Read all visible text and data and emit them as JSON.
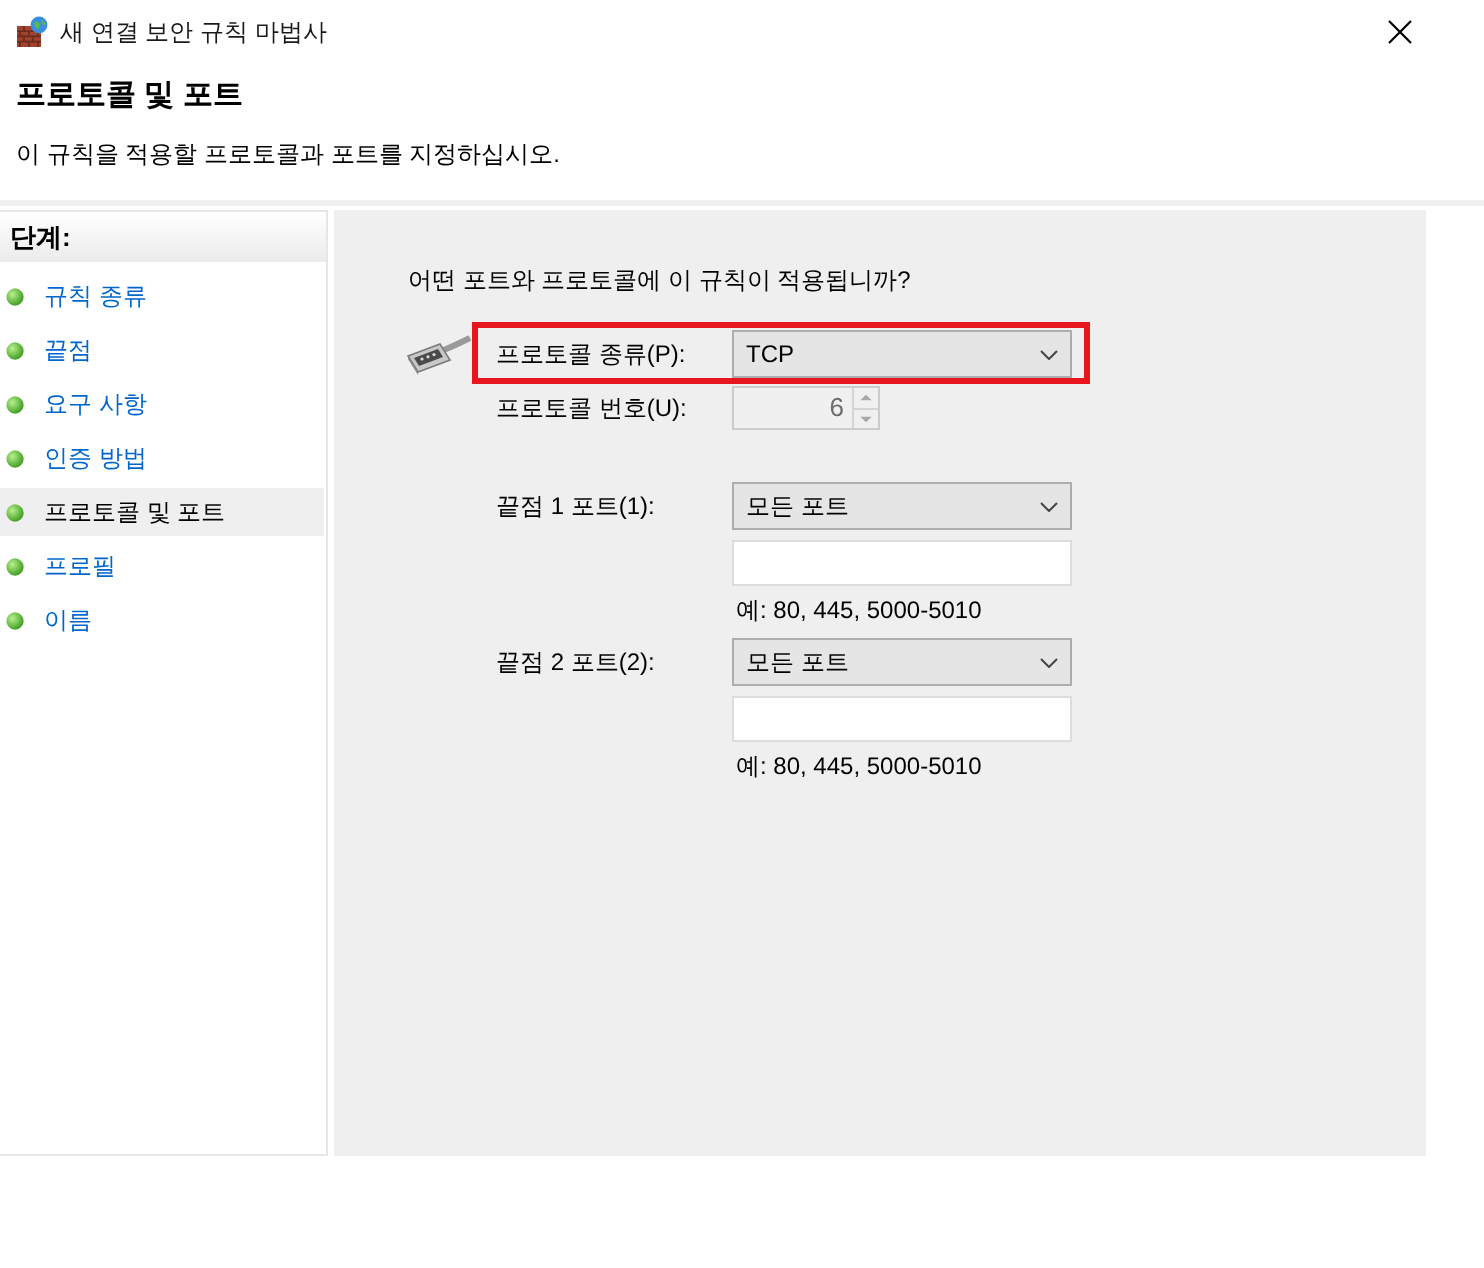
{
  "window": {
    "title": "새 연결 보안 규칙 마법사"
  },
  "header": {
    "title": "프로토콜 및 포트",
    "subtitle": "이 규칙을 적용할 프로토콜과 포트를 지정하십시오."
  },
  "steps": {
    "heading": "단계:",
    "items": [
      {
        "label": "규칙 종류",
        "selected": false
      },
      {
        "label": "끝점",
        "selected": false
      },
      {
        "label": "요구 사항",
        "selected": false
      },
      {
        "label": "인증 방법",
        "selected": false
      },
      {
        "label": "프로토콜 및 포트",
        "selected": true
      },
      {
        "label": "프로필",
        "selected": false
      },
      {
        "label": "이름",
        "selected": false
      }
    ]
  },
  "form": {
    "question": "어떤 포트와 프로토콜에 이 규칙이 적용됩니까?",
    "protocol_type": {
      "label": "프로토콜 종류(P):",
      "value": "TCP",
      "highlighted": true
    },
    "protocol_number": {
      "label": "프로토콜 번호(U):",
      "value": "6",
      "disabled": true
    },
    "endpoints": [
      {
        "label": "끝점 1 포트(1):",
        "value": "모든 포트",
        "input_disabled": true,
        "example": "예: 80, 445, 5000-5010"
      },
      {
        "label": "끝점 2 포트(2):",
        "value": "모든 포트",
        "input_disabled": true,
        "example": "예: 80, 445, 5000-5010"
      }
    ]
  }
}
